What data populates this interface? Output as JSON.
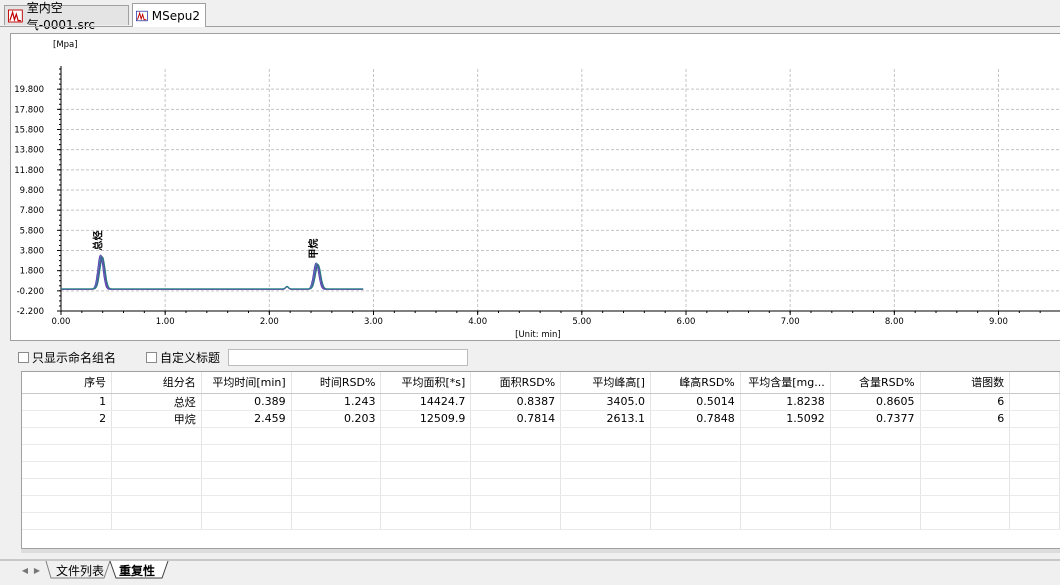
{
  "tabs": [
    {
      "label": "室内空气-0001.src",
      "active": false
    },
    {
      "label": "MSepu2",
      "active": true
    }
  ],
  "chart_data": {
    "type": "line",
    "ylabel": "[Mpa]",
    "xlabel": "[Unit: min]",
    "ylim": [
      -2.2,
      21.8
    ],
    "xlim": [
      0,
      9.6
    ],
    "y_ticks": [
      "19.800",
      "17.800",
      "15.800",
      "13.800",
      "11.800",
      "9.800",
      "7.800",
      "5.800",
      "3.800",
      "1.800",
      "-0.200",
      "-2.200"
    ],
    "y_tick_values": [
      19.8,
      17.8,
      15.8,
      13.8,
      11.8,
      9.8,
      7.8,
      5.8,
      3.8,
      1.8,
      -0.2,
      -2.2
    ],
    "x_ticks": [
      "0.00",
      "1.00",
      "2.00",
      "3.00",
      "4.00",
      "5.00",
      "6.00",
      "7.00",
      "8.00",
      "9.00"
    ],
    "x_tick_values": [
      0,
      1,
      2,
      3,
      4,
      5,
      6,
      7,
      8,
      9
    ],
    "grid": true,
    "peaks": [
      {
        "name": "总烃",
        "rt": 0.389,
        "height": 3.4
      },
      {
        "name": "甲烷",
        "rt": 2.459,
        "height": 2.6
      }
    ],
    "small_peak": {
      "rt": 2.17,
      "height": 0.25
    },
    "trace_end": 2.9,
    "series_colors": [
      "#2020a0",
      "#b040c0",
      "#20a0a0",
      "#5050d0",
      "#903090",
      "#208080"
    ]
  },
  "options": {
    "show_named_only": "只显示命名组名",
    "custom_title": "自定义标题"
  },
  "table": {
    "columns": [
      "序号",
      "组分名",
      "平均时间[min]",
      "时间RSD%",
      "平均面积[*s]",
      "面积RSD%",
      "平均峰高[]",
      "峰高RSD%",
      "平均含量[mg...",
      "含量RSD%",
      "谱图数"
    ],
    "rows": [
      [
        "1",
        "总烃",
        "0.389",
        "1.243",
        "14424.7",
        "0.8387",
        "3405.0",
        "0.5014",
        "1.8238",
        "0.8605",
        "6"
      ],
      [
        "2",
        "甲烷",
        "2.459",
        "0.203",
        "12509.9",
        "0.7814",
        "2613.1",
        "0.7848",
        "1.5092",
        "0.7377",
        "6"
      ]
    ]
  },
  "bottom_tabs": [
    {
      "label": "文件列表",
      "active": false
    },
    {
      "label": "重复性",
      "active": true
    }
  ]
}
